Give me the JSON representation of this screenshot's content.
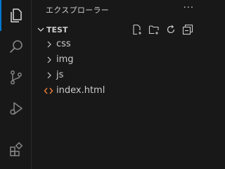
{
  "sidebar": {
    "title": "エクスプローラー",
    "more": "···",
    "section": {
      "title": "TEST",
      "actions": [
        "new-file",
        "new-folder",
        "refresh",
        "collapse-all"
      ]
    },
    "tree": [
      {
        "label": "css",
        "kind": "folder"
      },
      {
        "label": "img",
        "kind": "folder"
      },
      {
        "label": "js",
        "kind": "folder"
      },
      {
        "label": "index.html",
        "kind": "file"
      }
    ]
  },
  "activity_bar": {
    "items": [
      "explorer-icon",
      "search-icon",
      "source-control-icon",
      "run-debug-icon",
      "extensions-icon"
    ],
    "active": "explorer-icon"
  },
  "colors": {
    "background": "#181818",
    "text": "#cccccc",
    "accent": "#0078d4",
    "html_icon": "#e37933"
  }
}
